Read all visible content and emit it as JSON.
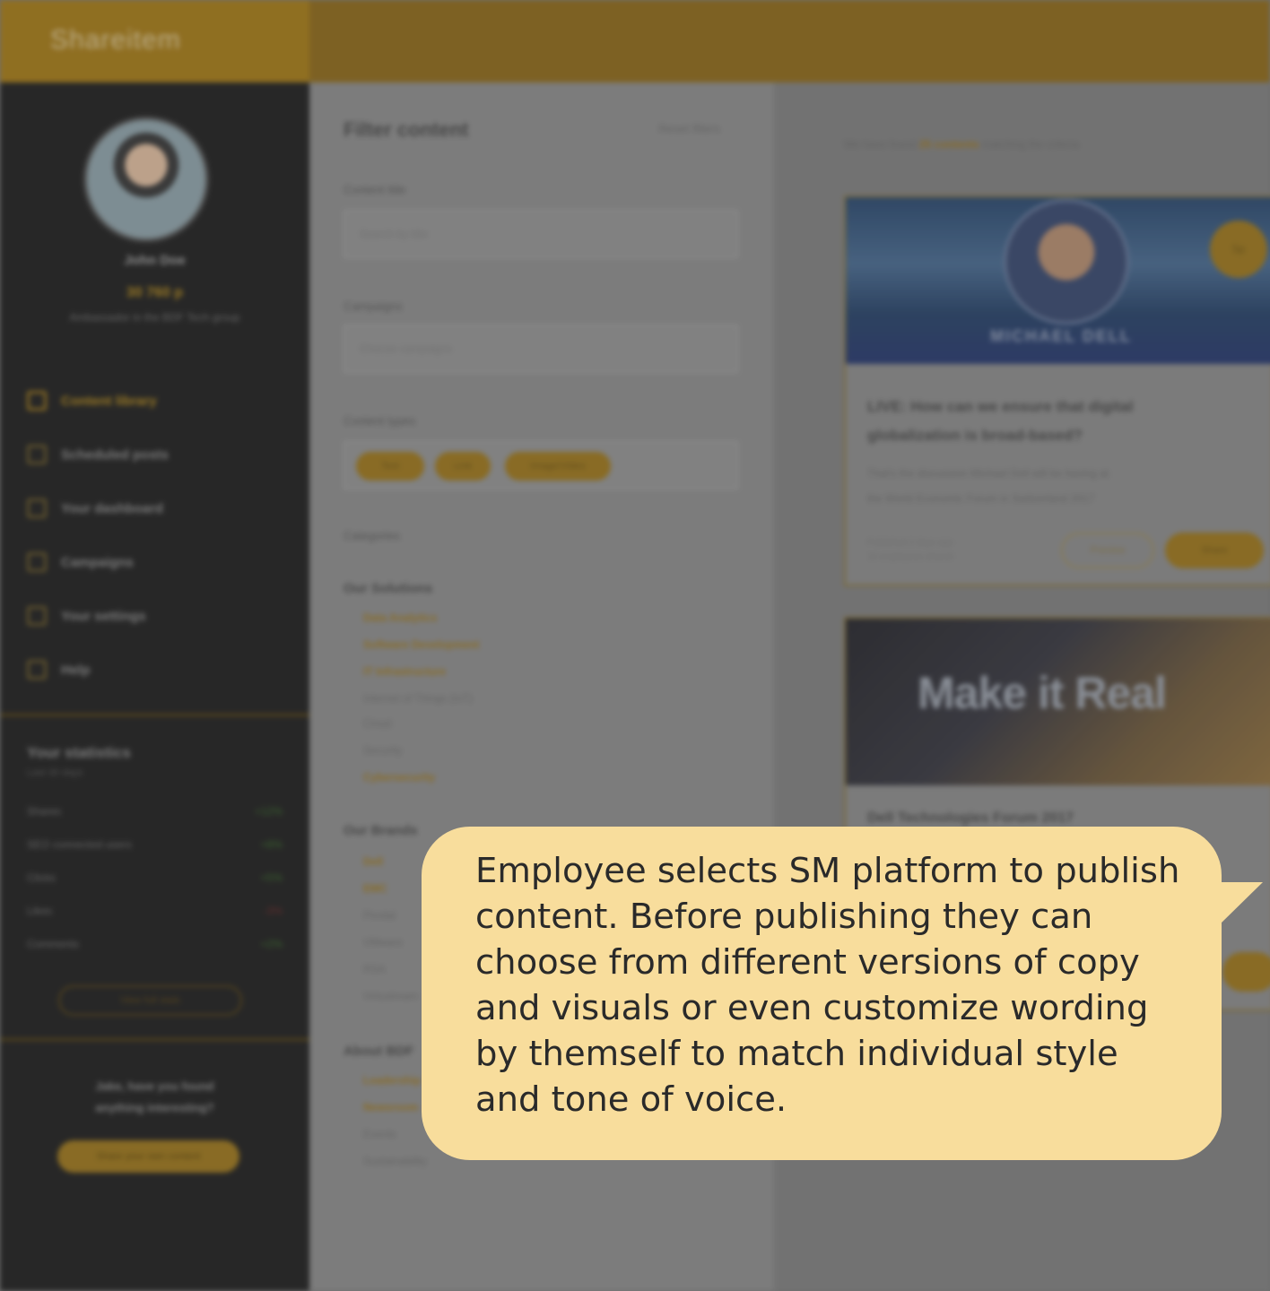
{
  "app": {
    "logo": "Shareitem",
    "colors": {
      "accent": "#F8DD9C",
      "brand": "#A27A1C"
    }
  },
  "sidebar": {
    "user": {
      "name": "John Doe",
      "points": "30 760 p",
      "rank": "Ambassador in the BDF Tech group"
    },
    "nav": [
      {
        "label": "Content library",
        "icon": "library-icon"
      },
      {
        "label": "Scheduled posts",
        "icon": "calendar-icon"
      },
      {
        "label": "Your dashboard",
        "icon": "dashboard-icon"
      },
      {
        "label": "Campaigns",
        "icon": "megaphone-icon"
      },
      {
        "label": "Your settings",
        "icon": "gear-icon"
      },
      {
        "label": "Help",
        "icon": "help-icon"
      }
    ],
    "stats": {
      "title": "Your statistics",
      "subtitle": "Last 30 days",
      "rows": [
        {
          "label": "Shares",
          "value": "+12%"
        },
        {
          "label": "SEO connected users",
          "value": "+8%"
        },
        {
          "label": "Clicks",
          "value": "+5%"
        },
        {
          "label": "Likes",
          "value": "-3%"
        },
        {
          "label": "Comments",
          "value": "+2%"
        }
      ],
      "button": "View full stats"
    },
    "promo": {
      "text_line1": "Jake, have you found",
      "text_line2": "anything interesting?",
      "button": "Share your own content"
    }
  },
  "filter": {
    "title": "Filter content",
    "reset": "Reset filters",
    "content_title_label": "Content title",
    "content_title_placeholder": "Search by title",
    "campaigns_label": "Campaigns",
    "campaigns_placeholder": "Choose campaigns",
    "content_types_label": "Content types",
    "content_types": [
      "Text",
      "Link",
      "Image/Video"
    ],
    "categories_label": "Categories",
    "groups": [
      {
        "name": "Our Solutions",
        "items": [
          "Data Analytics",
          "Software Development",
          "IT Infrastructure",
          "Internet of Things (IoT)",
          "Cloud",
          "Security",
          "Cybersecurity"
        ]
      },
      {
        "name": "Our Brands",
        "items": [
          "Dell",
          "EMC",
          "Pivotal",
          "VMware",
          "RSA",
          "Virtustream"
        ]
      },
      {
        "name": "About BDF",
        "items": [
          "Leadership",
          "Newsroom",
          "Events",
          "Sustainability"
        ]
      }
    ]
  },
  "feed": {
    "header_prefix": "We have found",
    "header_count": "25 contents",
    "header_suffix": "matching the criteria",
    "card1": {
      "image_name": "MICHAEL DELL",
      "badge": "5p",
      "title_line1": "LIVE: How can we ensure that digital",
      "title_line2": "globalization is broad-based?",
      "text_line1": "That's the discussion Michael Dell will be having at",
      "text_line2": "the World Economic Forum in Switzerland 2017",
      "meta_line1": "Published 2 days ago",
      "meta_line2": "12 employees shared",
      "btn_secondary": "Preview",
      "btn_primary": "Share"
    },
    "card2": {
      "image_text": "Make it Real",
      "title": "Dell Technologies Forum 2017"
    }
  },
  "tooltip": {
    "line1": "Employee selects SM platform to publish",
    "line2": "content. Before publishing they can",
    "line3": "choose from different versions of copy",
    "line4": "and visuals or even customize wording",
    "line5": "by themself to match individual style",
    "line6": "and tone of voice."
  }
}
